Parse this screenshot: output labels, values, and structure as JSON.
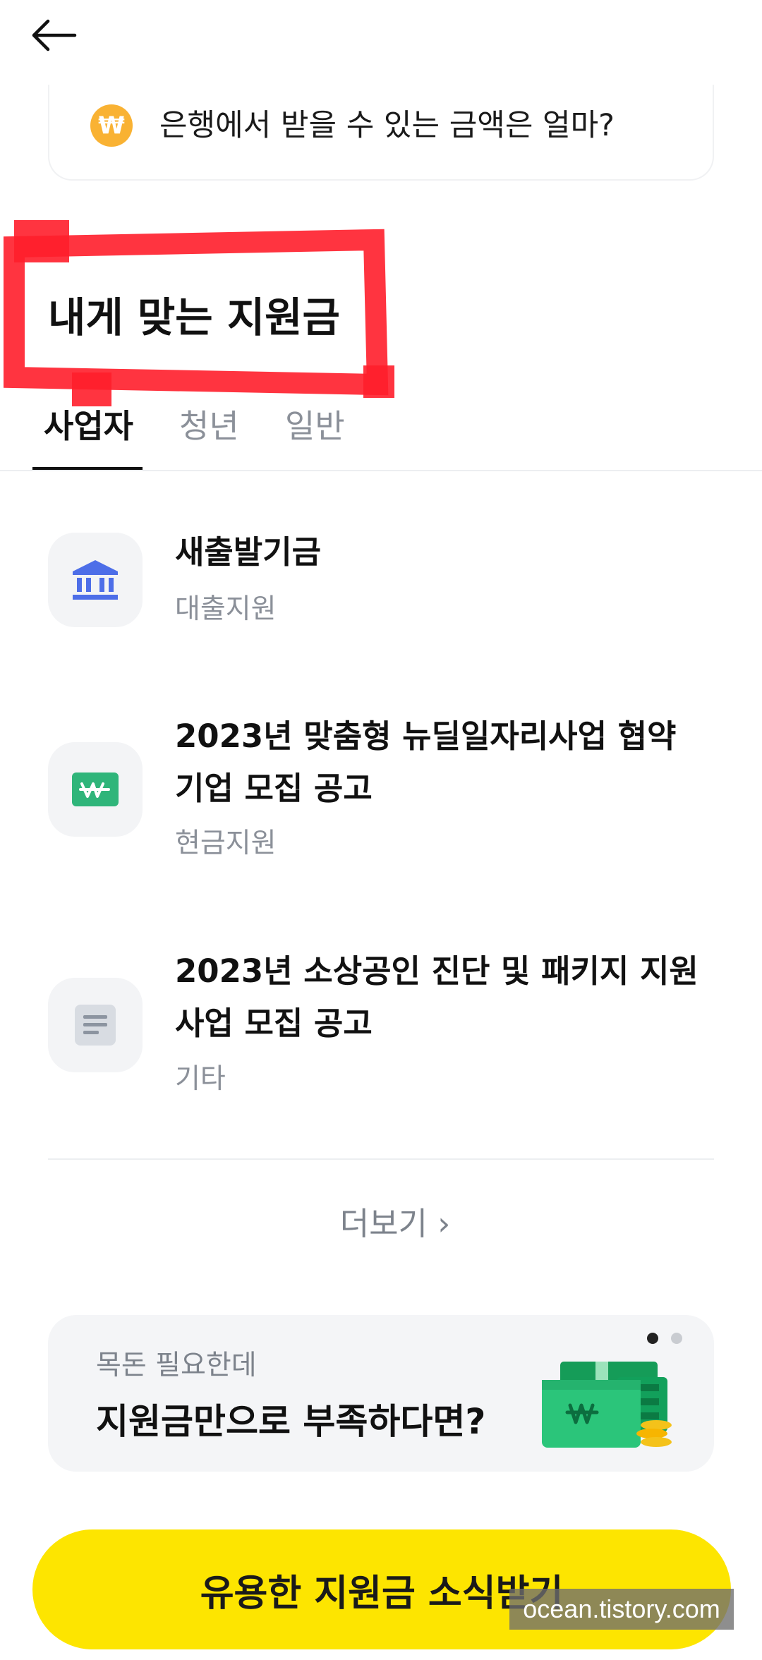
{
  "header": {
    "back_icon": "arrow-left-icon"
  },
  "bank_card": {
    "icon": "won-coin-icon",
    "symbol": "₩",
    "text": "은행에서 받을 수 있는 금액은 얼마?"
  },
  "section": {
    "title": "내게 맞는 지원금"
  },
  "tabs": [
    {
      "label": "사업자",
      "active": true
    },
    {
      "label": "청년",
      "active": false
    },
    {
      "label": "일반",
      "active": false
    }
  ],
  "items": [
    {
      "icon": "bank-building-icon",
      "title_lines": [
        "새출발기금"
      ],
      "category": "대출지원"
    },
    {
      "icon": "won-bill-icon",
      "title_lines": [
        "2023년 맞춤형 뉴딜일자리사업 협약",
        "기업 모집 공고"
      ],
      "category": "현금지원"
    },
    {
      "icon": "document-icon",
      "title_lines": [
        "2023년 소상공인 진단 및 패키지 지원",
        "사업 모집 공고"
      ],
      "category": "기타"
    }
  ],
  "more": {
    "label": "더보기 ›"
  },
  "loan_banner": {
    "subtitle": "목돈 필요한데",
    "title": "지원금만으로 부족하다면?",
    "image": "money-stack-icon",
    "page_dots": {
      "total": 2,
      "active": 1
    }
  },
  "cta": {
    "label": "유용한 지원금 소식받기"
  },
  "watermark": {
    "text": "ocean.tistory.com"
  },
  "colors": {
    "cta_yellow": "#fde500",
    "annotation_red": "#ff1e2b",
    "won_coin": "#f9b233",
    "bank_blue": "#4d6ee8",
    "won_green": "#2fb57a"
  }
}
